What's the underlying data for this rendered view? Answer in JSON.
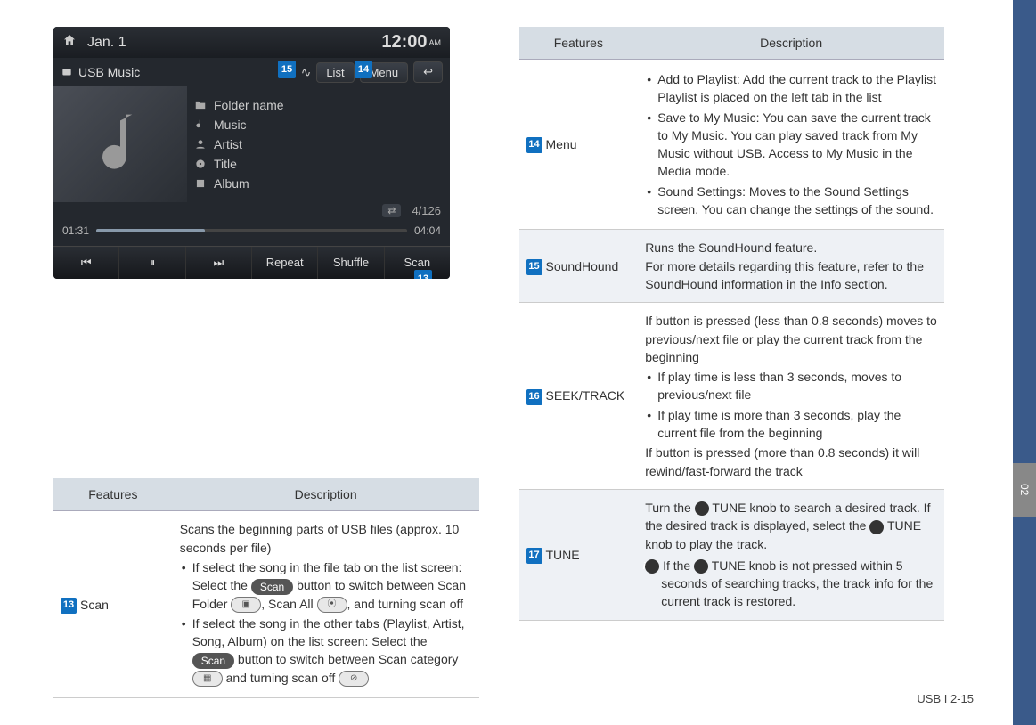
{
  "sideTab": "02",
  "screenshot": {
    "date": "Jan.  1",
    "clock": "12:00",
    "ampm": "AM",
    "subTitle": "USB Music",
    "listBtn": "List",
    "menuBtn": "Menu",
    "meta": {
      "folder": "Folder name",
      "music": "Music",
      "artist": "Artist",
      "title": "Title",
      "album": "Album"
    },
    "trackCount": "4/126",
    "t1": "01:31",
    "t2": "04:04",
    "controls": {
      "prev": "⏮",
      "pause": "⏸",
      "next": "⏭",
      "repeat": "Repeat",
      "shuffle": "Shuffle",
      "scan": "Scan"
    },
    "callouts": {
      "c13": "13",
      "c14": "14",
      "c15": "15"
    }
  },
  "leftTable": {
    "hFeat": "Features",
    "hDesc": "Description",
    "scan": {
      "num": "13",
      "label": "Scan",
      "intro": "Scans the beginning parts of USB files (approx. 10 seconds per file)",
      "b1a": "If select the song in the file tab on the list screen: Select the ",
      "scanBtn": "Scan",
      "b1b": " button to switch between Scan Folder ",
      "b1c": ", Scan All ",
      "b1d": ", and turning scan off",
      "b2a": "If select the song in the other tabs (Playlist, Artist, Song, Album) on the list screen: Select the ",
      "b2b": " button to switch between Scan cat­egory ",
      "b2c": " and turning scan off "
    }
  },
  "rightTable": {
    "hFeat": "Features",
    "hDesc": "Description",
    "menu": {
      "num": "14",
      "label": "Menu",
      "b1": "Add to Playlist: Add the current track to the Playlist Playlist is placed on the left tab in the list",
      "b2": "Save to My Music: You can save the current track to My Music. You can play saved track from My Music without USB.  Access to My Music in the Media mode.",
      "b3": "Sound Settings: Moves to the Sound Settings screen. You can change the set­tings of the sound."
    },
    "sh": {
      "num": "15",
      "label": "SoundHound",
      "l1": "Runs the SoundHound feature.",
      "l2": "For more details regarding this feature, refer to the SoundHound information in the Info section."
    },
    "seek": {
      "num": "16",
      "label": "SEEK/TRACK",
      "l1": "If button is pressed (less than 0.8 seconds) moves to previous/next file or play the current track from the beginning",
      "b1": "If play time is less than 3 seconds, moves to previous/next file",
      "b2": "If play time is more than 3 seconds, play the current file from the beginning",
      "l2": "If button is pressed (more than 0.8 seconds) it will rewind/fast-forward the track"
    },
    "tune": {
      "num": "17",
      "label": "TUNE",
      "l1a": "Turn the ",
      "kn1": "TUNE",
      "l1b": " knob to search a desired track. If the desired track is displayed, select the ",
      "kn2": "TUNE",
      "l1c": " knob to play the track.",
      "l2a": "If the ",
      "kn3": "TUNE",
      "l2b": " knob is not pressed within 5 seconds of searching tracks, the track info for the current track is restored."
    }
  },
  "footer": "USB I 2-15"
}
